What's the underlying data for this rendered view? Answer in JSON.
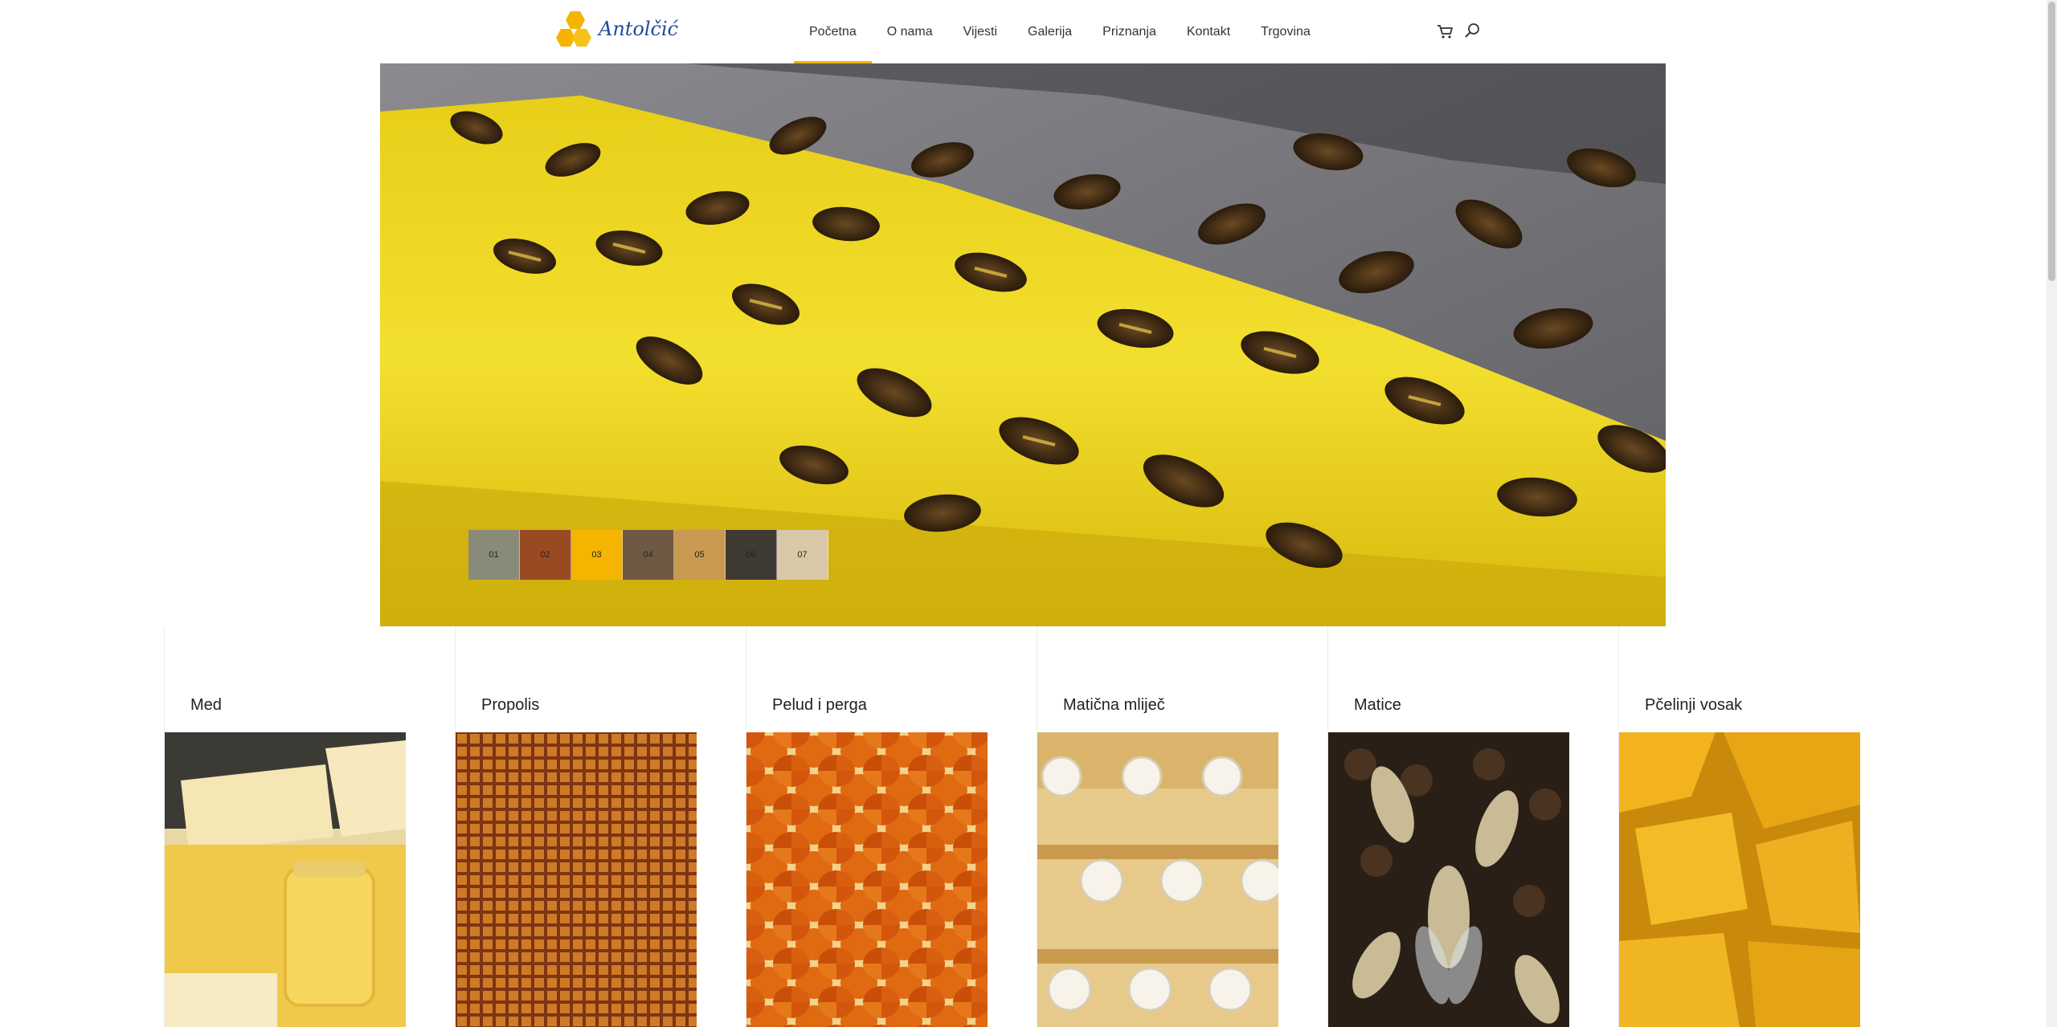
{
  "logo": {
    "text": "Antolčić"
  },
  "nav": {
    "items": [
      {
        "label": "Početna",
        "active": true
      },
      {
        "label": "O nama",
        "active": false
      },
      {
        "label": "Vijesti",
        "active": false
      },
      {
        "label": "Galerija",
        "active": false
      },
      {
        "label": "Priznanja",
        "active": false
      },
      {
        "label": "Kontakt",
        "active": false
      },
      {
        "label": "Trgovina",
        "active": false
      }
    ],
    "cart_icon": "cart-icon",
    "search_icon": "search-icon"
  },
  "slider": {
    "thumbs": [
      "01",
      "02",
      "03",
      "04",
      "05",
      "06",
      "07"
    ],
    "active": "03"
  },
  "products": [
    {
      "title": "Med"
    },
    {
      "title": "Propolis"
    },
    {
      "title": "Pelud i perga"
    },
    {
      "title": "Matična mliječ"
    },
    {
      "title": "Matice"
    },
    {
      "title": "Pčelinji vosak"
    }
  ],
  "colors": {
    "accent": "#f5b400",
    "logo_blue": "#1f4b9a"
  }
}
